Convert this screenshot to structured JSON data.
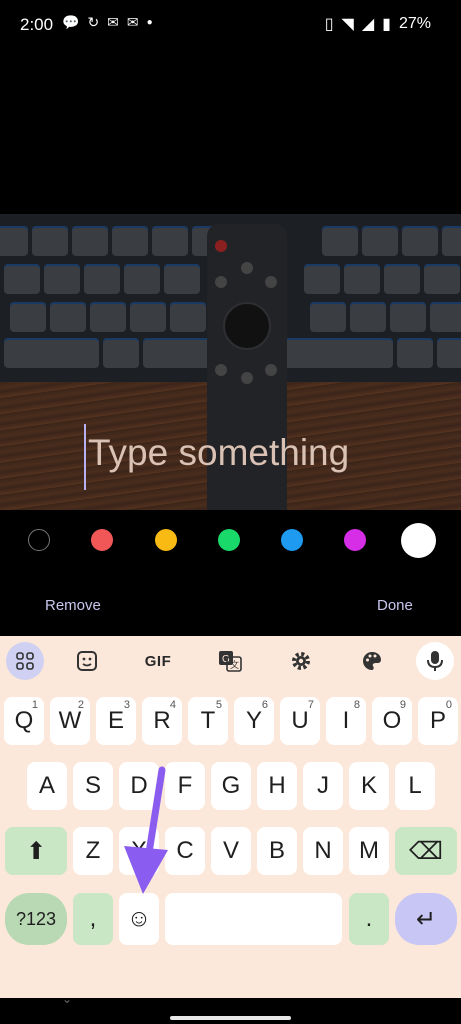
{
  "status": {
    "time": "2:00",
    "battery": "27%",
    "left_icons": [
      "chat-bubble-icon",
      "sync-icon",
      "mail-icon",
      "mail-icon",
      "dot"
    ],
    "right_icons": [
      "vibrate-icon",
      "wifi-icon",
      "signal-icon",
      "battery-icon"
    ]
  },
  "editor": {
    "text_placeholder": "Type something",
    "colors": [
      "#000000",
      "#f25757",
      "#f9bb13",
      "#1ad96b",
      "#1e9bf0",
      "#d62de6",
      "#ffffff"
    ],
    "remove_label": "Remove",
    "done_label": "Done"
  },
  "keyboard": {
    "toolbar": {
      "gif_label": "GIF",
      "icons": [
        "apps-grid-icon",
        "sticker-icon",
        "gif",
        "translate-icon",
        "settings-icon",
        "palette-icon",
        "mic-icon"
      ]
    },
    "row1": [
      {
        "k": "Q",
        "h": "1"
      },
      {
        "k": "W",
        "h": "2"
      },
      {
        "k": "E",
        "h": "3"
      },
      {
        "k": "R",
        "h": "4"
      },
      {
        "k": "T",
        "h": "5"
      },
      {
        "k": "Y",
        "h": "6"
      },
      {
        "k": "U",
        "h": "7"
      },
      {
        "k": "I",
        "h": "8"
      },
      {
        "k": "O",
        "h": "9"
      },
      {
        "k": "P",
        "h": "0"
      }
    ],
    "row2": [
      "A",
      "S",
      "D",
      "F",
      "G",
      "H",
      "J",
      "K",
      "L"
    ],
    "row3": [
      "Z",
      "X",
      "C",
      "V",
      "B",
      "N",
      "M"
    ],
    "symbols_label": "?123",
    "comma": ",",
    "period": ".",
    "emoji_glyph": "☺",
    "enter_glyph": "↵",
    "shift_glyph": "⬆",
    "backspace_glyph": "⌫"
  },
  "annotation": {
    "color": "#8a5cf0"
  }
}
